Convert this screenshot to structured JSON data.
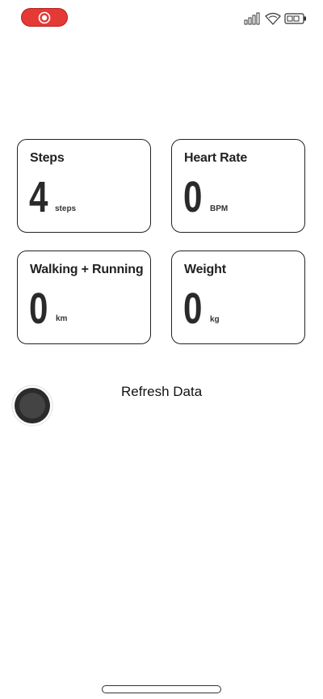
{
  "status_bar": {
    "record_icon": "record-icon",
    "icons": [
      "signal-icon",
      "wifi-icon",
      "battery-icon"
    ]
  },
  "cards": [
    {
      "title": "Steps",
      "value": "4",
      "unit": "steps"
    },
    {
      "title": "Heart Rate",
      "value": "0",
      "unit": "BPM"
    },
    {
      "title": "Walking + Running",
      "value": "0",
      "unit": "km"
    },
    {
      "title": "Weight",
      "value": "0",
      "unit": "kg"
    }
  ],
  "refresh": {
    "label": "Refresh Data"
  },
  "colors": {
    "accent": "#e53935",
    "text": "#222222",
    "background": "#ffffff"
  }
}
